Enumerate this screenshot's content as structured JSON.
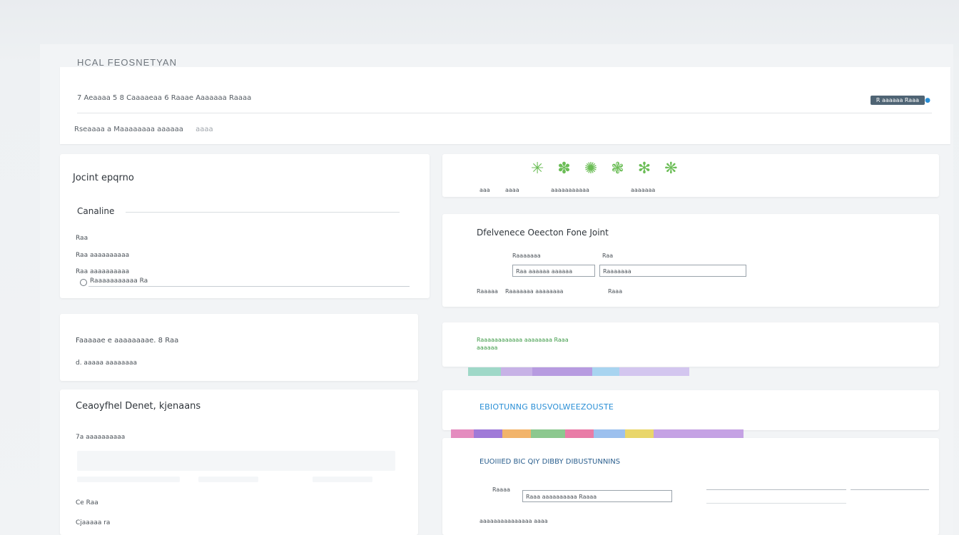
{
  "app": {
    "title": "HCAL FEOSNETYAN"
  },
  "header": {
    "row1_text": "7 Aeaaaa 5 8 Caaaaeaa 6 Raaae Aaaaaaa Raaaa",
    "row2_text": "Rseaaaa a Maaaaaaaa aaaaaa",
    "row2_muted": "aaaa",
    "action_button": "R aaaaaa Raaa",
    "action_icon": "arrow-icon"
  },
  "left": {
    "card1": {
      "title": "Jocint epqrno",
      "section": "Canaline",
      "rows": [
        "Raa",
        "Raa aaaaaaaaaa",
        "Raa aaaaaaaaaa",
        "Raaaaaaaaaaa Ra"
      ]
    },
    "card2": {
      "line1": "Faaaaae e aaaaaaaae. 8 Raa",
      "line2": "d. aaaaa aaaaaaaa"
    },
    "card3": {
      "title": "Ceaoyfhel Denet, kjenaans",
      "row1": "7a aaaaaaaaaa",
      "row2": "Ce Raa",
      "row3": "Cjaaaaa ra"
    }
  },
  "right": {
    "banner": {
      "glyphs": "✳ ✽ ✺ ❃ ✻ ❋",
      "caption_left": "aaa",
      "caption_mid": "aaaa",
      "caption_main": "aaaaaaaaaaa",
      "caption_right": "aaaaaaa"
    },
    "form_card": {
      "title": "Dfelvenece Oeecton Fone Joint",
      "label1": "Raaaaaaa",
      "label2": "Raa",
      "field1_value": "Raa aaaaaa aaaaaa",
      "field2_value": "Raaaaaaa",
      "note_a": "Raaaaa",
      "note_b": "Raaaaaaa aaaaaaaa",
      "note_c": "Raaa"
    },
    "status_card": {
      "line1": "Raaaaaaaaaaaa aaaaaaaa Raaa",
      "line2": "aaaaaa"
    },
    "heading_card": {
      "title": "EBIOTUNNG BUSVOLWEEZOUSTE"
    },
    "bottom_card": {
      "title": "EUOIIIED BIC QIY DIBBY DIBUSTUNNINS",
      "label": "Raaaa",
      "field_value": "Raaa aaaaaaaaaa Raaaa",
      "footer": "aaaaaaaaaaaaaaa aaaa"
    }
  },
  "colors": {
    "accent_blue": "#2a8fd6",
    "accent_green": "#3f9b48",
    "button_dark": "#4f6474"
  }
}
